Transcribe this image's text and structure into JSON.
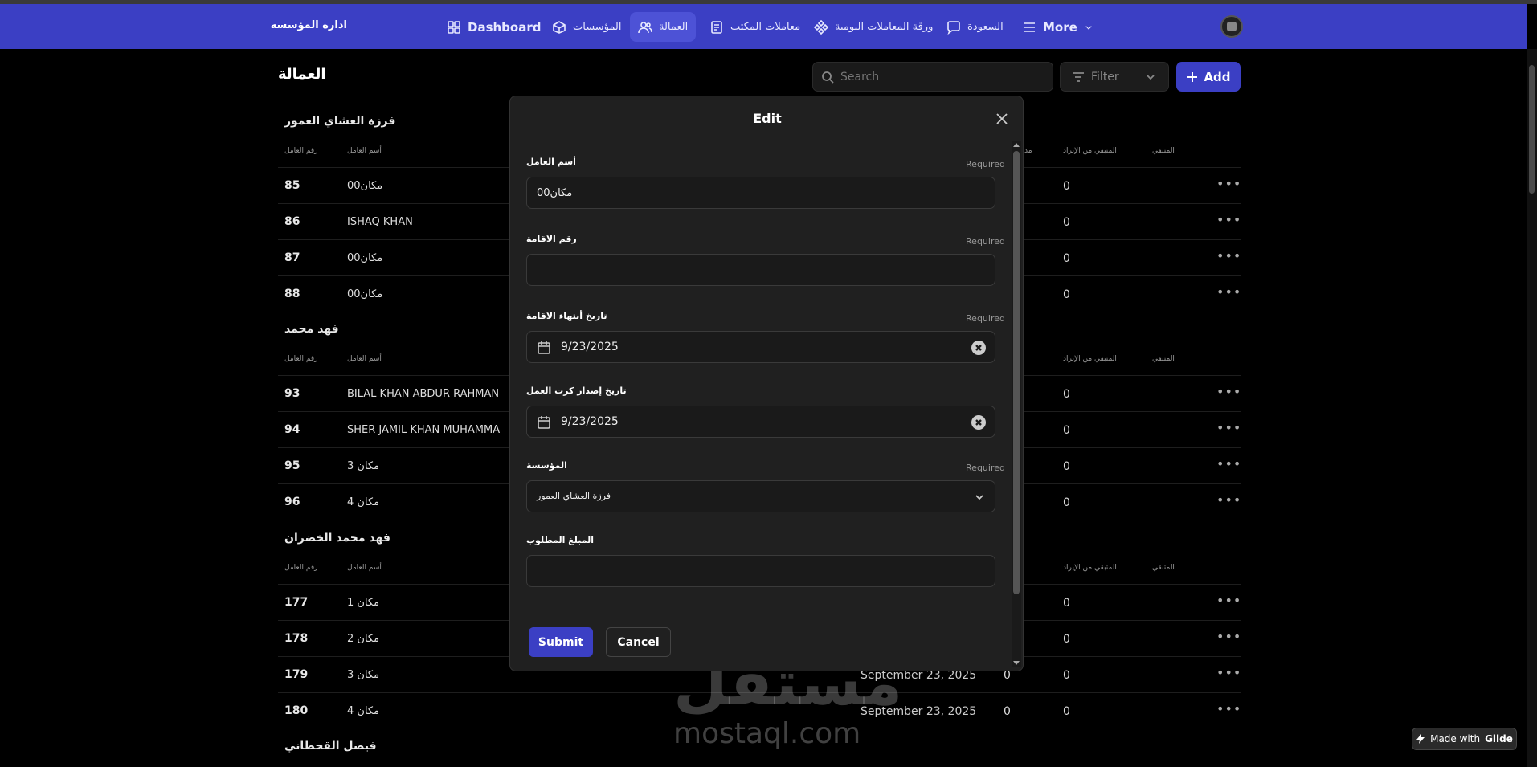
{
  "nav": {
    "brand": "اداره المؤسسه",
    "items": [
      {
        "label": "Dashboard",
        "icon": "grid-icon"
      },
      {
        "label": "المؤسسات",
        "icon": "box-icon"
      },
      {
        "label": "العمالة",
        "icon": "users-icon",
        "active": true
      },
      {
        "label": "معاملات المكتب",
        "icon": "document-icon"
      },
      {
        "label": "ورقة المعاملات اليومية",
        "icon": "diamond-grid-icon"
      },
      {
        "label": "السعودة",
        "icon": "chat-icon"
      },
      {
        "label": "More",
        "icon": "menu-icon"
      }
    ]
  },
  "page": {
    "title": "العمالة",
    "search_placeholder": "Search",
    "filter_label": "Filter",
    "add_label": "Add"
  },
  "columns": {
    "number": "رقم العامل",
    "name": "أسم العامل",
    "col_cut": "مد",
    "remaining_from_income": "المتبقي من الإيراد",
    "remaining": "المتبقي"
  },
  "groups": [
    {
      "title": "فرزة العشاي العمور",
      "rows": [
        {
          "num": "85",
          "name": "مكان00",
          "date": "",
          "v1": "",
          "v2": "0"
        },
        {
          "num": "86",
          "name": "ISHAQ KHAN",
          "date": "",
          "v1": "",
          "v2": "0"
        },
        {
          "num": "87",
          "name": "مكان00",
          "date": "",
          "v1": "",
          "v2": "0"
        },
        {
          "num": "88",
          "name": "مكان00",
          "date": "",
          "v1": "",
          "v2": "0"
        }
      ]
    },
    {
      "title": "فهد محمد",
      "rows": [
        {
          "num": "93",
          "name": "BILAL KHAN ABDUR RAHMAN",
          "date": "",
          "v1": "",
          "v2": "0"
        },
        {
          "num": "94",
          "name": "SHER JAMIL KHAN MUHAMMA",
          "date": "",
          "v1": "",
          "v2": "0"
        },
        {
          "num": "95",
          "name": "مكان 3",
          "date": "",
          "v1": "",
          "v2": "0"
        },
        {
          "num": "96",
          "name": "مكان 4",
          "date": "",
          "v1": "",
          "v2": "0"
        }
      ]
    },
    {
      "title": "فهد محمد الخضران",
      "rows": [
        {
          "num": "177",
          "name": "مكان 1",
          "date": "",
          "v1": "",
          "v2": "0"
        },
        {
          "num": "178",
          "name": "مكان 2",
          "date": "",
          "v1": "",
          "v2": "0"
        },
        {
          "num": "179",
          "name": "مكان 3",
          "date": "September 23, 2025",
          "v1": "0",
          "v2": "0"
        },
        {
          "num": "180",
          "name": "مكان 4",
          "date": "September 23, 2025",
          "v1": "0",
          "v2": "0"
        }
      ]
    },
    {
      "title": "فيصل القحطاني",
      "rows": []
    }
  ],
  "modal": {
    "title": "Edit",
    "required_label": "Required",
    "fields": {
      "worker_name": {
        "label": "أسم العامل",
        "value": "مكان00",
        "required": true
      },
      "residence_number": {
        "label": "رقم الاقامة",
        "value": "",
        "required": true
      },
      "residence_expiry": {
        "label": "تاريخ أنتهاء الاقامة",
        "value": "9/23/2025",
        "required": true
      },
      "work_card_issue": {
        "label": "تاريخ إصدار كرت العمل",
        "value": "9/23/2025",
        "required": false
      },
      "institution": {
        "label": "المؤسسة",
        "value": "فرزة العشاي العمور",
        "required": true
      },
      "amount_due": {
        "label": "المبلغ المطلوب",
        "value": "",
        "required": false
      }
    },
    "submit_label": "Submit",
    "cancel_label": "Cancel"
  },
  "watermark": {
    "arabic": "مستقل",
    "latin": "mostaql.com"
  },
  "glide_badge": {
    "prefix": "Made with",
    "brand": "Glide"
  }
}
